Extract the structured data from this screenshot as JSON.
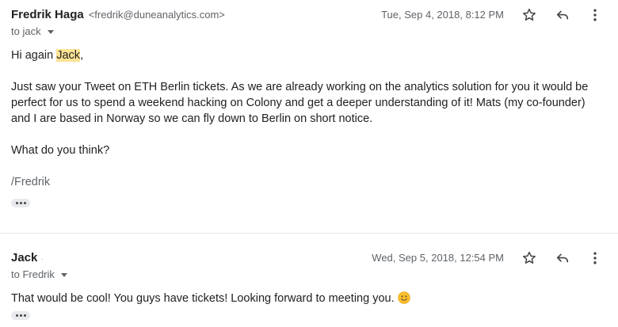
{
  "messages": [
    {
      "sender_name": "Fredrik Haga",
      "sender_email": "<fredrik@duneanalytics.com>",
      "recipients": "to jack",
      "date": "Tue, Sep 4, 2018, 8:12 PM",
      "greeting_prefix": "Hi again ",
      "greeting_name": "Jack",
      "greeting_suffix": ",",
      "paragraph": "Just saw your Tweet on ETH Berlin tickets. As we are already working on the analytics solution for you it would be perfect for us to spend a weekend hacking on Colony and get a deeper understanding of it! Mats (my co-founder) and I are based in Norway so we can fly down to Berlin on short notice.",
      "question": "What do you think?",
      "signature": "/Fredrik"
    },
    {
      "sender_name": "Jack",
      "presence": "·",
      "recipients": "to Fredrik",
      "date": "Wed, Sep 5, 2018, 12:54 PM",
      "body": "That would be cool! You guys have tickets! Looking forward to meeting you."
    }
  ],
  "icons": {
    "star": "star-icon",
    "reply": "reply-icon",
    "more": "more-vert-icon",
    "emoji": "smiling-face-emoji",
    "trimmed": "show-trimmed-content-icon"
  },
  "colors": {
    "highlight": "#fde293",
    "secondary_text": "#5f6368",
    "primary_text": "#202124"
  }
}
